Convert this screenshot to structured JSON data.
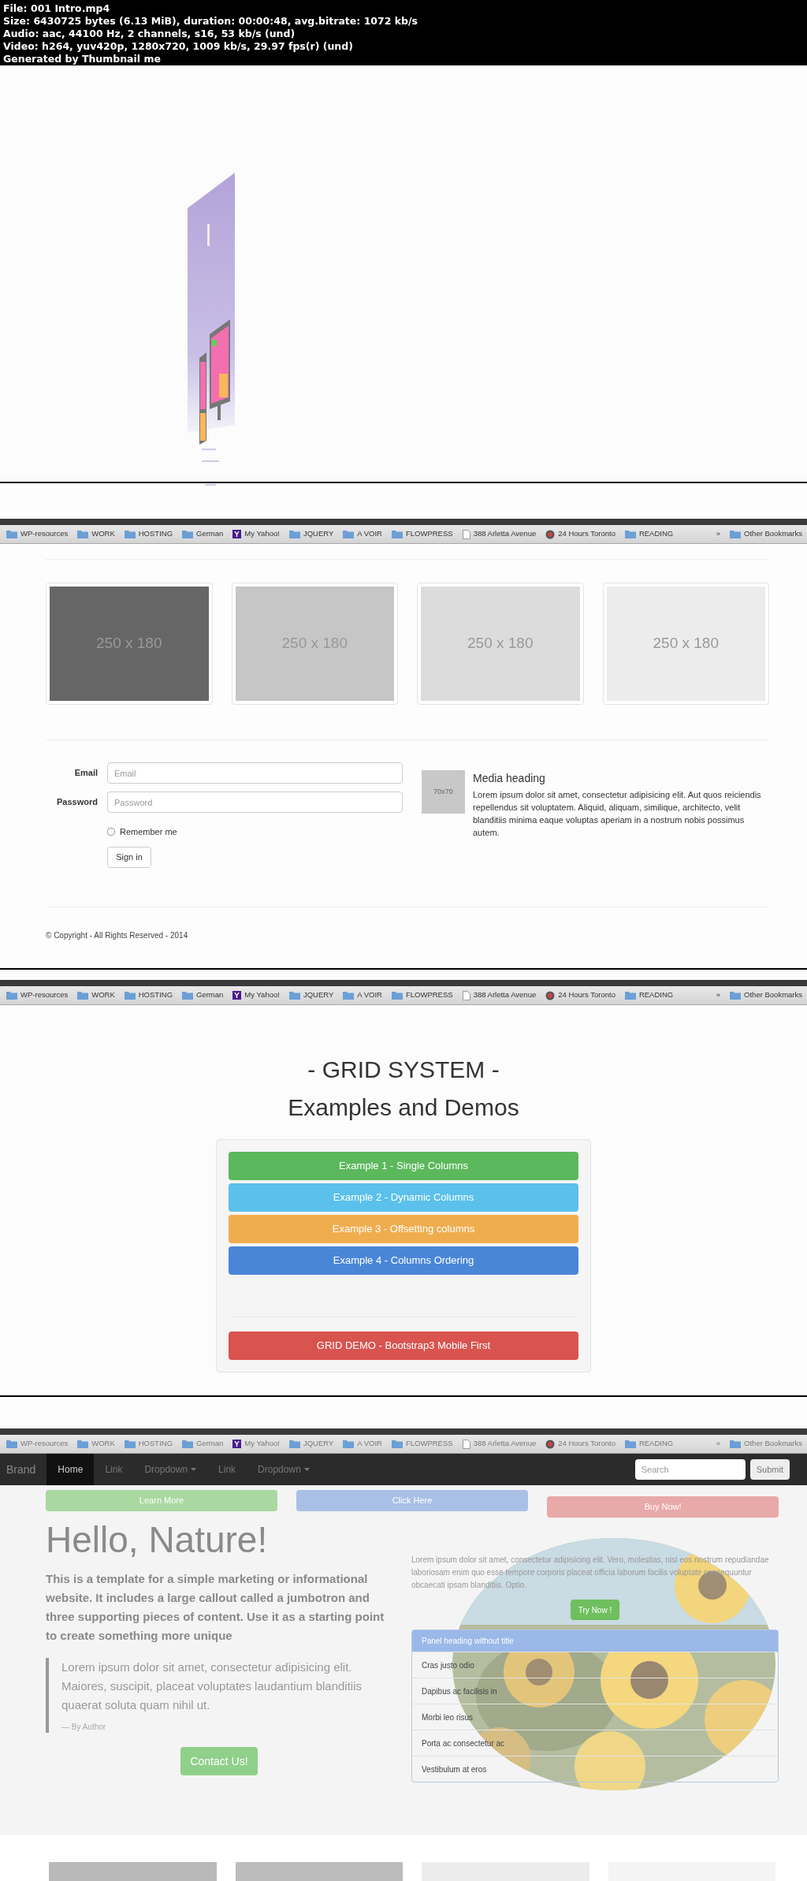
{
  "info_header": {
    "lines": [
      "File: 001 Intro.mp4",
      "Size: 6430725 bytes (6.13 MiB), duration: 00:00:48, avg.bitrate: 1072 kb/s",
      "Audio: aac, 44100 Hz, 2 channels, s16, 53 kb/s (und)",
      "Video: h264, yuv420p, 1280x720, 1009 kb/s, 29.97 fps(r) (und)",
      "Generated by Thumbnail me"
    ]
  },
  "frames": [
    {
      "kind": "slide"
    },
    {
      "kind": "form_page",
      "bookmarks": {
        "items": [
          {
            "kind": "folder",
            "label": "WP-resources"
          },
          {
            "kind": "folder",
            "label": "WORK"
          },
          {
            "kind": "folder",
            "label": "HOSTING"
          },
          {
            "kind": "folder",
            "label": "German"
          },
          {
            "kind": "yahoo",
            "label": "My Yahoo!"
          },
          {
            "kind": "folder",
            "label": "JQUERY"
          },
          {
            "kind": "folder",
            "label": "A VOIR"
          },
          {
            "kind": "folder",
            "label": "FLOWPRESS"
          },
          {
            "kind": "page",
            "label": "388 Arletta Avenue"
          },
          {
            "kind": "globe",
            "label": "24 Hours Toronto"
          },
          {
            "kind": "folder",
            "label": "READING"
          }
        ],
        "overflow": "»",
        "other": "Other Bookmarks"
      },
      "thumbnails": [
        {
          "label": "250 x 180",
          "color": "#666666"
        },
        {
          "label": "250 x 180",
          "color": "#c6c6c6"
        },
        {
          "label": "250 x 180",
          "color": "#dcdcdc"
        },
        {
          "label": "250 x 180",
          "color": "#ececec"
        }
      ],
      "form": {
        "fields": [
          {
            "label": "Email",
            "placeholder": "Email"
          },
          {
            "label": "Password",
            "placeholder": "Password"
          }
        ],
        "remember": {
          "label": "Remember me",
          "checked": false
        },
        "submit": "Sign in"
      },
      "media": {
        "thumb": "70x70",
        "heading": "Media heading",
        "body": "Lorem ipsum dolor sit amet, consectetur adipisicing elit. Aut quos reiciendis repellendus sit voluptatem. Aliquid, aliquam, similique, architecto, velit blanditiis minima eaque voluptas aperiam in a nostrum nobis possimus autem."
      },
      "footer": "© Copyright - All Rights Reserved - 2014"
    },
    {
      "kind": "grid_menu",
      "bookmarks": {
        "items": [
          {
            "kind": "folder",
            "label": "WP-resources"
          },
          {
            "kind": "folder",
            "label": "WORK"
          },
          {
            "kind": "folder",
            "label": "HOSTING"
          },
          {
            "kind": "folder",
            "label": "German"
          },
          {
            "kind": "yahoo",
            "label": "My Yahoo!"
          },
          {
            "kind": "folder",
            "label": "JQUERY"
          },
          {
            "kind": "folder",
            "label": "A VOIR"
          },
          {
            "kind": "folder",
            "label": "FLOWPRESS"
          },
          {
            "kind": "page",
            "label": "388 Arletta Avenue"
          },
          {
            "kind": "globe",
            "label": "24 Hours Toronto"
          },
          {
            "kind": "folder",
            "label": "READING"
          }
        ],
        "overflow": "»",
        "other": "Other Bookmarks"
      },
      "title": "- GRID SYSTEM -",
      "subtitle": "Examples and Demos",
      "buttons": [
        {
          "label": "Example 1 - Single Columns",
          "color": "#5cb85c"
        },
        {
          "label": "Example 2 - Dynamic Columns",
          "color": "#5bc0eb"
        },
        {
          "label": "Example 3 - Offsetting columns",
          "color": "#f0ad4e"
        },
        {
          "label": "Example 4 - Columns Ordering",
          "color": "#4a86d8"
        }
      ],
      "demo_button": {
        "label": "GRID DEMO - Bootstrap3 Mobile First",
        "color": "#d9534f"
      }
    },
    {
      "kind": "nature_page",
      "bookmarks": {
        "items": [
          {
            "kind": "folder",
            "label": "WP-resources"
          },
          {
            "kind": "folder",
            "label": "WORK"
          },
          {
            "kind": "folder",
            "label": "HOSTING"
          },
          {
            "kind": "folder",
            "label": "German"
          },
          {
            "kind": "yahoo",
            "label": "My Yahoo!"
          },
          {
            "kind": "folder",
            "label": "JQUERY"
          },
          {
            "kind": "folder",
            "label": "A VOIR"
          },
          {
            "kind": "folder",
            "label": "FLOWPRESS"
          },
          {
            "kind": "page",
            "label": "388 Arletta Avenue"
          },
          {
            "kind": "globe",
            "label": "24 Hours Toronto"
          },
          {
            "kind": "folder",
            "label": "READING"
          }
        ],
        "overflow": "»",
        "other": "Other Bookmarks"
      },
      "nav": {
        "brand": "Brand",
        "items": [
          {
            "kind": "link",
            "label": "Home",
            "selected": true
          },
          {
            "kind": "link",
            "label": "Link",
            "selected": false
          },
          {
            "kind": "dropdown",
            "label": "Dropdown",
            "selected": false
          },
          {
            "kind": "link",
            "label": "Link",
            "selected": false
          },
          {
            "kind": "dropdown",
            "label": "Dropdown",
            "selected": false
          }
        ],
        "search": {
          "placeholder": "Search"
        },
        "submit": "Submit"
      },
      "top_buttons": [
        {
          "label": "Learn More",
          "color": "#a9d8a0"
        },
        {
          "label": "Click Here",
          "color": "#a9bfe6"
        },
        {
          "label": "Buy Now!",
          "color": "#e8a9a9"
        }
      ],
      "heading": "Hello, Nature!",
      "lead": "This is a template for a simple marketing or informational website. It includes a large callout called a jumbotron and three supporting pieces of content. Use it as a starting point to create something more unique",
      "quote": "Lorem ipsum dolor sit amet, consectetur adipisicing elit. Maiores, suscipit, placeat voluptates laudantium blanditiis quaerat soluta quam nihil ut.",
      "quote_author": "— By Author",
      "contact": "Contact Us!",
      "side_text": "Lorem ipsum dolor sit amet, consectetur adipisicing elit. Vero, molestias, nisi eos nostrum repudiandae laboriosam enim quo esse tempore corporis placeat officia laborum facilis voluptate consequuntur obcaecati ipsam blanditiis. Optio.",
      "try_button": "Try Now !",
      "panel": {
        "heading": "Panel heading without title",
        "items": [
          "Cras justo odio",
          "Dapibus ac facilisis in",
          "Morbi leo risus",
          "Porta ac consectetur ac",
          "Vestibulum at eros"
        ]
      }
    }
  ]
}
